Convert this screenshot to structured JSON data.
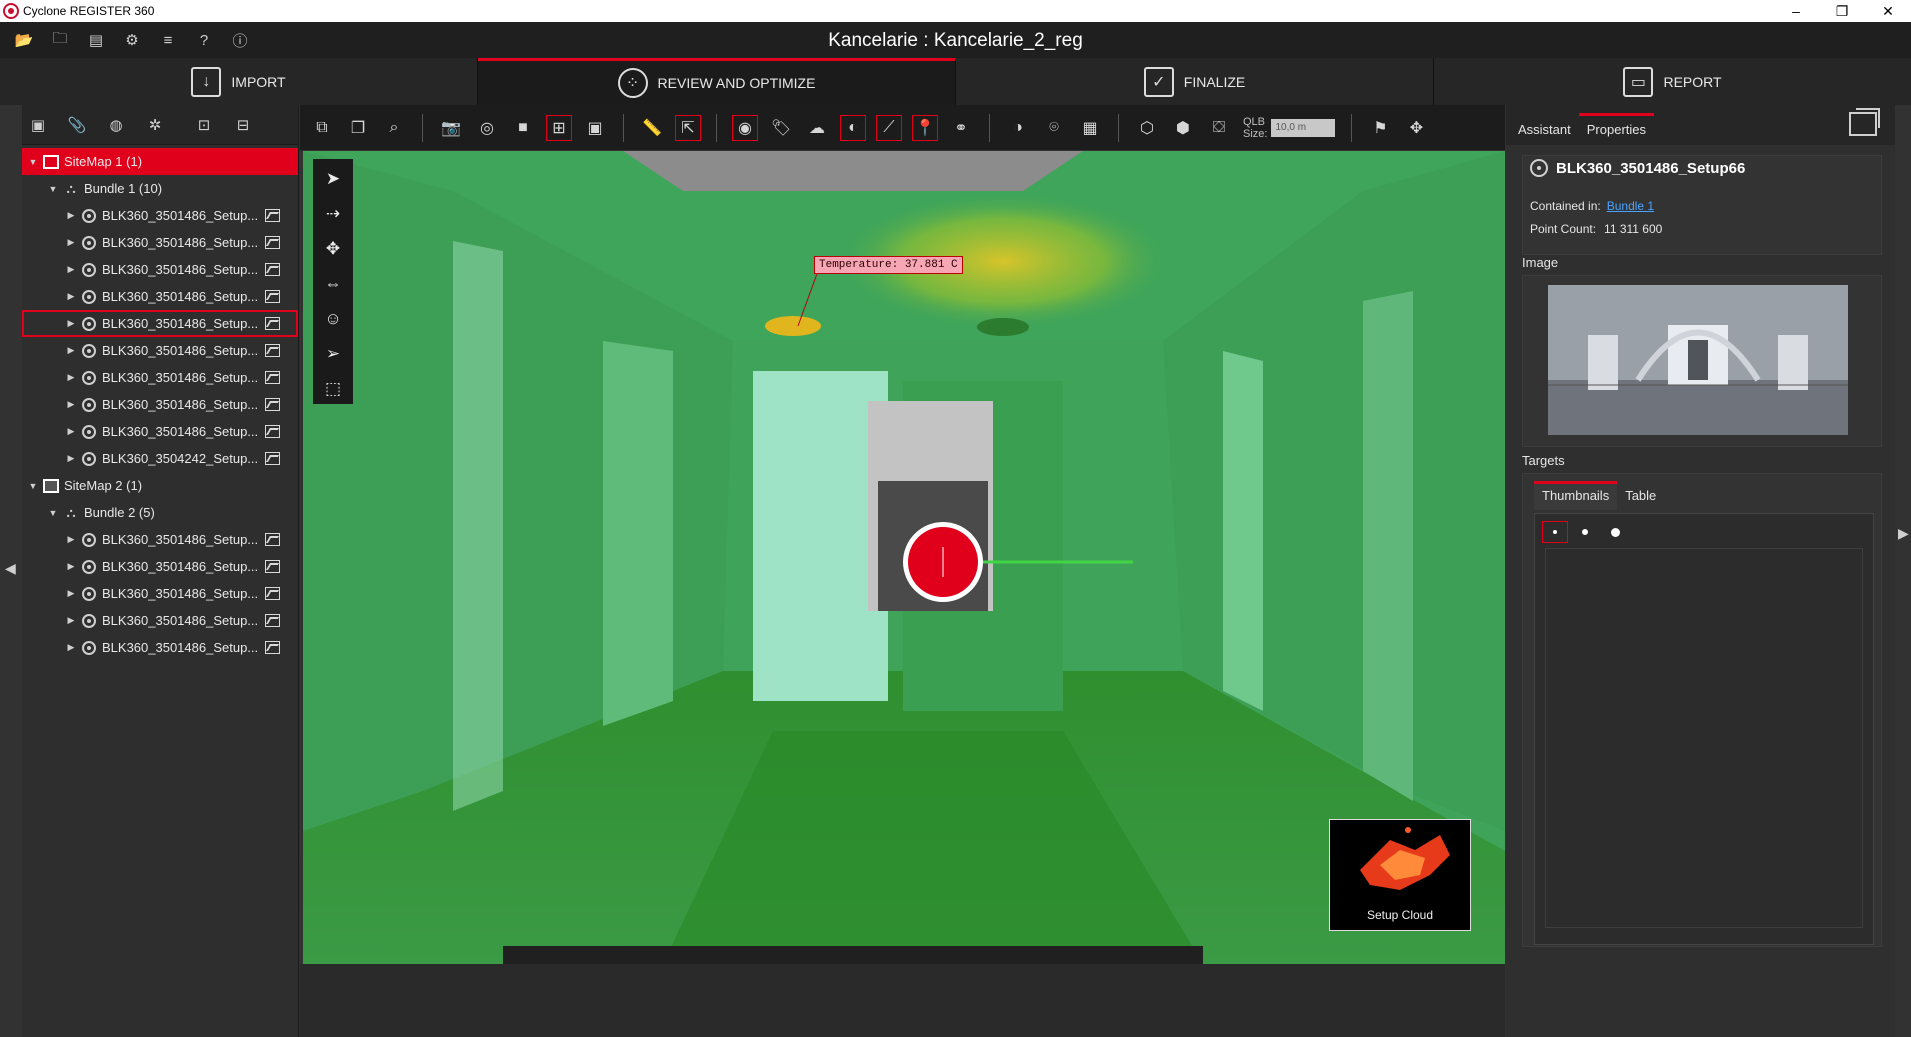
{
  "window": {
    "app_title": "Cyclone REGISTER 360",
    "minimize": "–",
    "restore": "❐",
    "close": "✕"
  },
  "document": {
    "title": "Kancelarie : Kancelarie_2_reg"
  },
  "workflow": {
    "tabs": [
      {
        "label": "IMPORT",
        "icon": "import-icon"
      },
      {
        "label": "REVIEW AND OPTIMIZE",
        "icon": "review-icon",
        "active": true
      },
      {
        "label": "FINALIZE",
        "icon": "finalize-icon"
      },
      {
        "label": "REPORT",
        "icon": "report-icon"
      }
    ]
  },
  "tree": {
    "sitemap1": "SiteMap 1 (1)",
    "bundle1": "Bundle 1 (10)",
    "bundle1_items": [
      "BLK360_3501486_Setup...",
      "BLK360_3501486_Setup...",
      "BLK360_3501486_Setup...",
      "BLK360_3501486_Setup...",
      "BLK360_3501486_Setup...",
      "BLK360_3501486_Setup...",
      "BLK360_3501486_Setup...",
      "BLK360_3501486_Setup...",
      "BLK360_3501486_Setup...",
      "BLK360_3504242_Setup..."
    ],
    "sitemap2": "SiteMap 2 (1)",
    "bundle2": "Bundle 2 (5)",
    "bundle2_items": [
      "BLK360_3501486_Setup...",
      "BLK360_3501486_Setup...",
      "BLK360_3501486_Setup...",
      "BLK360_3501486_Setup...",
      "BLK360_3501486_Setup..."
    ]
  },
  "toolbar": {
    "qlb_label_line1": "QLB",
    "qlb_label_line2": "Size:",
    "qlb_value": "10,0 m"
  },
  "viewport": {
    "temperature_label": "Temperature: 37.881 C",
    "setup_cloud_caption": "Setup Cloud"
  },
  "right_panel": {
    "tab_assistant": "Assistant",
    "tab_properties": "Properties",
    "setup_name": "BLK360_3501486_Setup66",
    "contained_in_label": "Contained in:",
    "contained_in_value": "Bundle 1",
    "point_count_label": "Point Count:",
    "point_count_value": "11 311 600",
    "image_section": "Image",
    "targets_section": "Targets",
    "targets_tab_thumbnails": "Thumbnails",
    "targets_tab_table": "Table"
  },
  "colors": {
    "accent": "#e0001b",
    "link": "#4aa3ff",
    "heatmap_green": "#3fa35a"
  }
}
